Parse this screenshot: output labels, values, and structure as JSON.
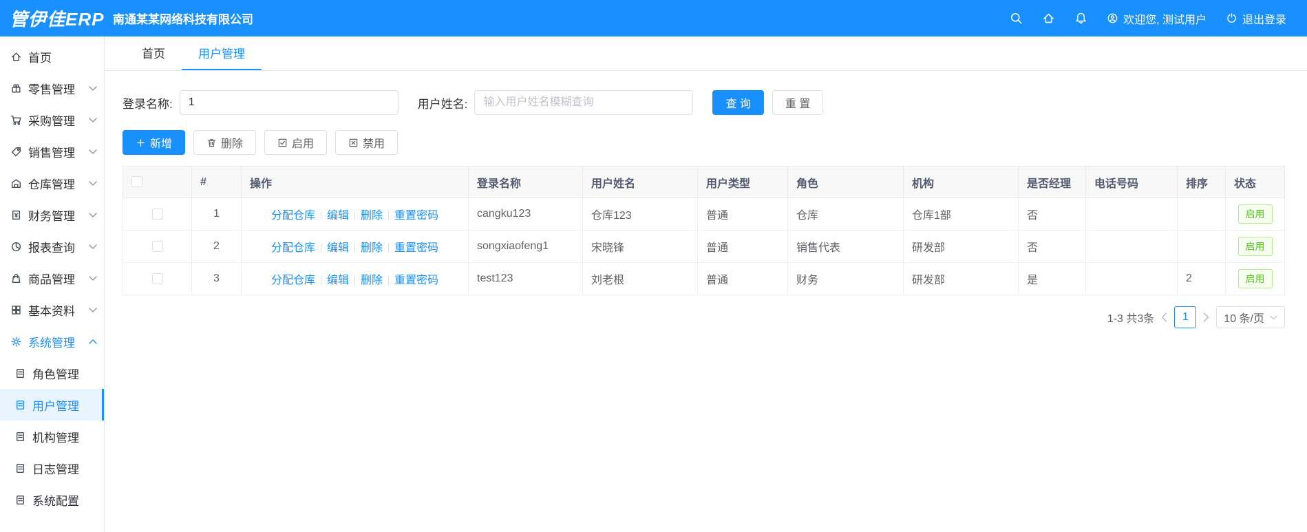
{
  "accent_color": "#1890ff",
  "header": {
    "logo": "管伊佳ERP",
    "company": "南通某某网络科技有限公司",
    "welcome": "欢迎您, 测试用户",
    "logout": "退出登录"
  },
  "sidebar": {
    "items": [
      {
        "label": "首页"
      },
      {
        "label": "零售管理"
      },
      {
        "label": "采购管理"
      },
      {
        "label": "销售管理"
      },
      {
        "label": "仓库管理"
      },
      {
        "label": "财务管理"
      },
      {
        "label": "报表查询"
      },
      {
        "label": "商品管理"
      },
      {
        "label": "基本资料"
      },
      {
        "label": "系统管理"
      }
    ],
    "subitems": [
      {
        "label": "角色管理"
      },
      {
        "label": "用户管理"
      },
      {
        "label": "机构管理"
      },
      {
        "label": "日志管理"
      },
      {
        "label": "系统配置"
      }
    ]
  },
  "tabs": [
    {
      "label": "首页"
    },
    {
      "label": "用户管理"
    }
  ],
  "filters": {
    "login_label": "登录名称:",
    "login_value": "1",
    "name_label": "用户姓名:",
    "name_placeholder": "输入用户姓名模糊查询",
    "search_button": "查 询",
    "reset_button": "重 置"
  },
  "toolbar": {
    "add": "新增",
    "delete": "删除",
    "enable": "启用",
    "disable": "禁用"
  },
  "table": {
    "headers": [
      "#",
      "操作",
      "登录名称",
      "用户姓名",
      "用户类型",
      "角色",
      "机构",
      "是否经理",
      "电话号码",
      "排序",
      "状态"
    ],
    "op_links": [
      "分配仓库",
      "编辑",
      "删除",
      "重置密码"
    ],
    "rows": [
      {
        "index": "1",
        "login": "cangku123",
        "name": "仓库123",
        "type": "普通",
        "role": "仓库",
        "org": "仓库1部",
        "manager": "否",
        "phone": "",
        "sort": "",
        "status": "启用"
      },
      {
        "index": "2",
        "login": "songxiaofeng1",
        "name": "宋晓锋",
        "type": "普通",
        "role": "销售代表",
        "org": "研发部",
        "manager": "否",
        "phone": "",
        "sort": "",
        "status": "启用"
      },
      {
        "index": "3",
        "login": "test123",
        "name": "刘老根",
        "type": "普通",
        "role": "财务",
        "org": "研发部",
        "manager": "是",
        "phone": "",
        "sort": "2",
        "status": "启用"
      }
    ]
  },
  "pagination": {
    "total": "1-3 共3条",
    "current_page": "1",
    "page_size": "10 条/页"
  }
}
